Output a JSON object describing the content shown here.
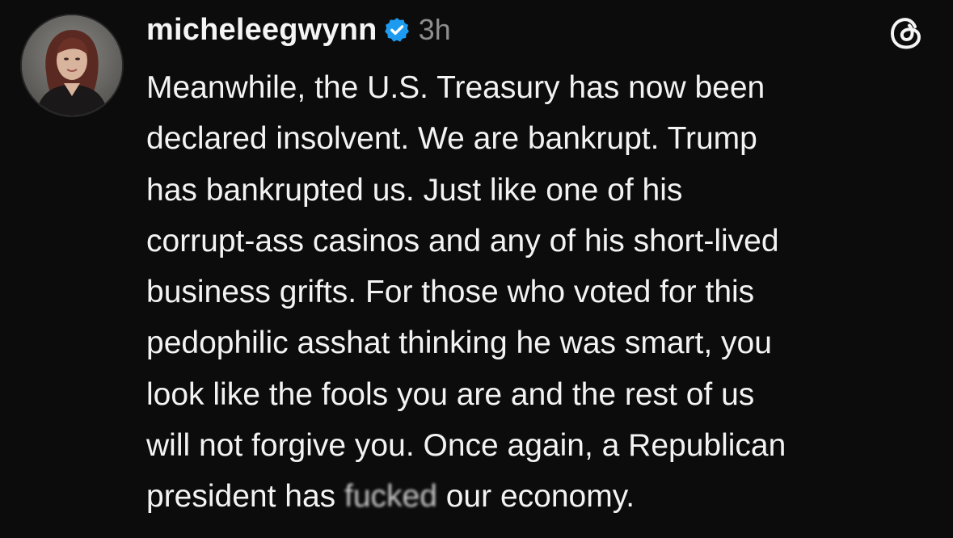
{
  "post": {
    "username": "micheleegwynn",
    "timestamp": "3h",
    "verified": true,
    "avatar_icon": "profile-photo-avatar",
    "logo_icon": "threads-logo-icon",
    "verified_icon": "verified-badge-icon",
    "accent_color": "#1d9bf0",
    "body_lines": [
      "Meanwhile, the U.S. Treasury has now been",
      "declared insolvent. We are bankrupt. Trump",
      "has bankrupted us. Just like one of his",
      "corrupt-ass casinos and any of his short-lived",
      "business grifts. For those who voted for this",
      "pedophilic asshat thinking he was smart, you",
      "look like the fools you are and the rest of us",
      "will not forgive you. Once again, a Republican"
    ],
    "last_line": {
      "before": "president has ",
      "smudged": "fucked",
      "after": " our economy."
    }
  }
}
